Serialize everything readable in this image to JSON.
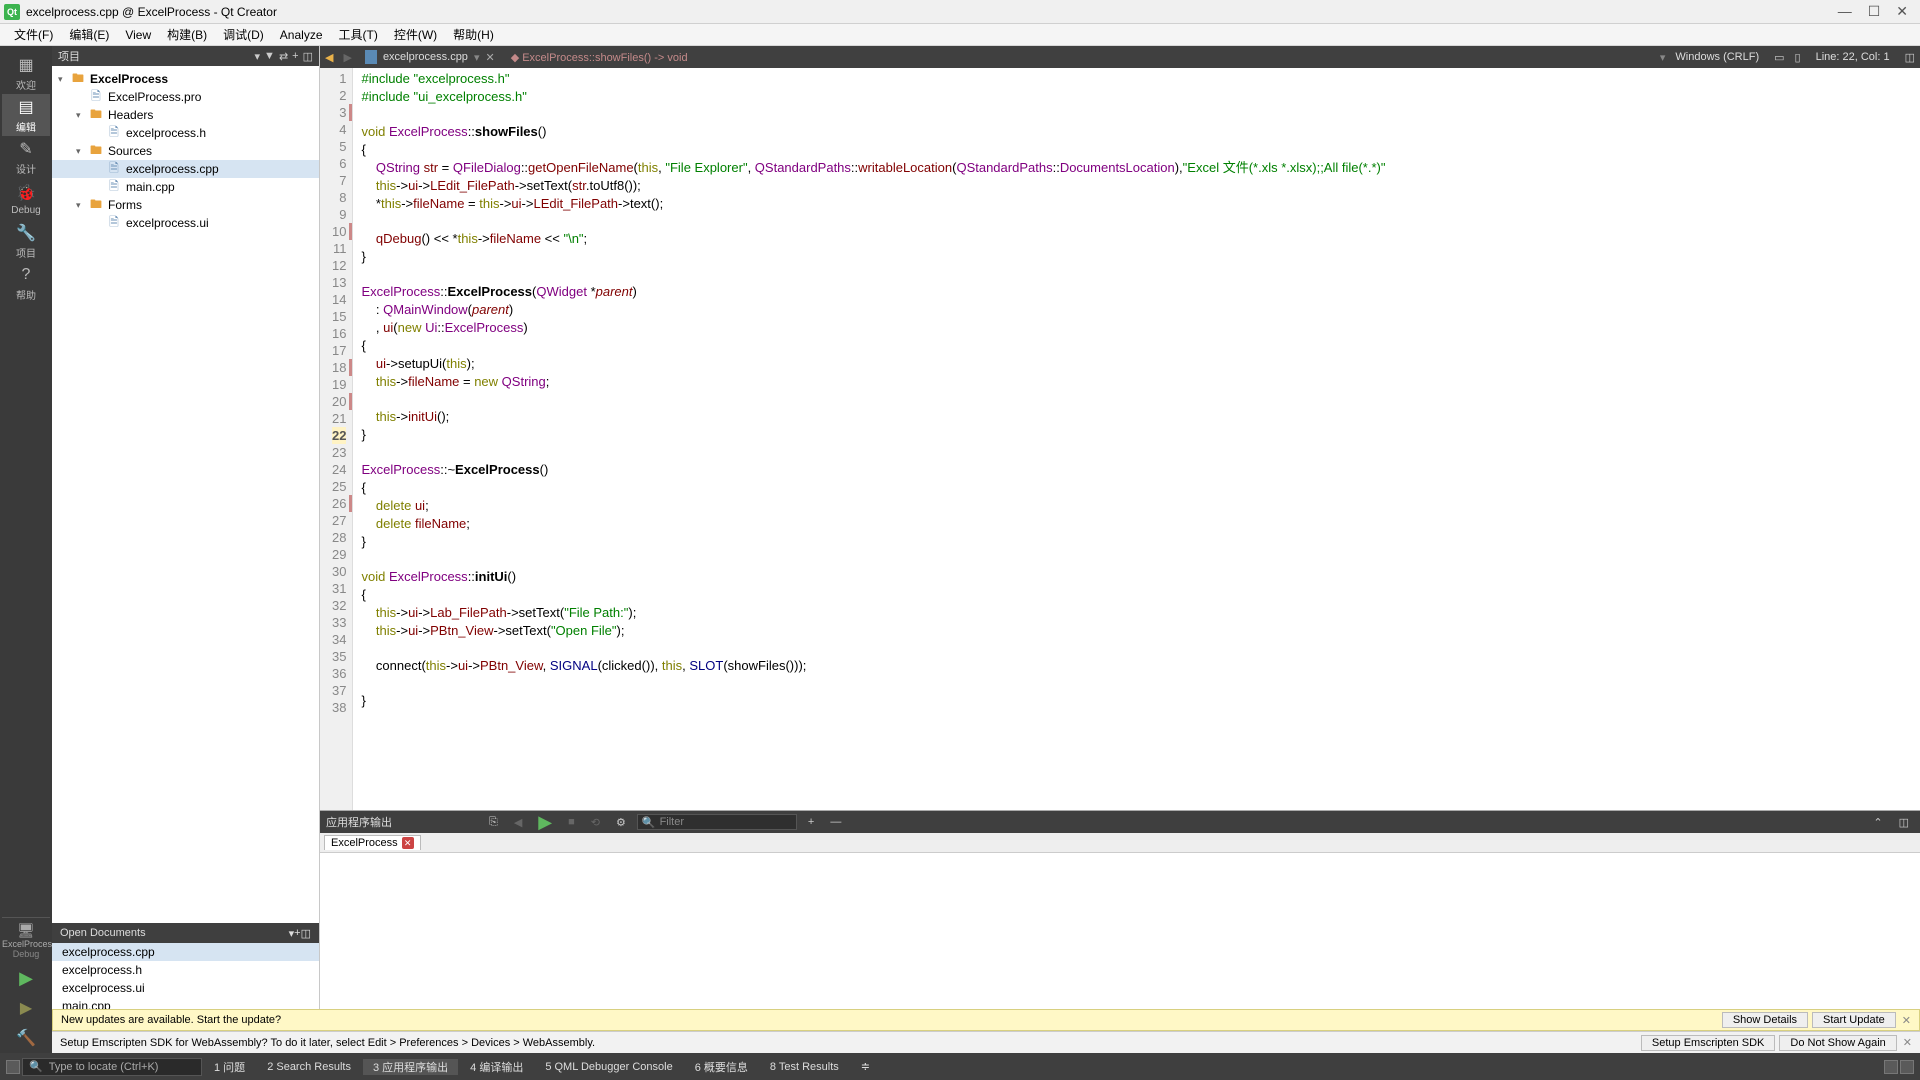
{
  "window": {
    "title": "excelprocess.cpp @ ExcelProcess - Qt Creator"
  },
  "menu": {
    "file": "文件(F)",
    "edit": "编辑(E)",
    "view": "View",
    "build": "构建(B)",
    "debug": "调试(D)",
    "analyze": "Analyze",
    "tools": "工具(T)",
    "widgets": "控件(W)",
    "help": "帮助(H)"
  },
  "rail": {
    "welcome": "欢迎",
    "edit": "编辑",
    "design": "设计",
    "debug": "Debug",
    "project": "项目",
    "help": "帮助",
    "target": "ExcelProcess",
    "config": "Debug"
  },
  "projectPane": {
    "title": "项目",
    "root": "ExcelProcess",
    "pro": "ExcelProcess.pro",
    "headers": "Headers",
    "h1": "excelprocess.h",
    "sources": "Sources",
    "s1": "excelprocess.cpp",
    "s2": "main.cpp",
    "forms": "Forms",
    "f1": "excelprocess.ui"
  },
  "openDocs": {
    "title": "Open Documents",
    "d1": "excelprocess.cpp",
    "d2": "excelprocess.h",
    "d3": "excelprocess.ui",
    "d4": "main.cpp"
  },
  "editor": {
    "filename": "excelprocess.cpp",
    "breadcrumb": "ExcelProcess::showFiles() -> void",
    "encoding": "Windows (CRLF)",
    "pos": "Line: 22, Col: 1"
  },
  "output": {
    "title": "应用程序输出",
    "filterPlaceholder": "Filter",
    "tab": "ExcelProcess"
  },
  "notif1": {
    "text": "New updates are available. Start the update?",
    "b1": "Show Details",
    "b2": "Start Update"
  },
  "notif2": {
    "text": "Setup Emscripten SDK for WebAssembly? To do it later, select Edit > Preferences > Devices > WebAssembly.",
    "b1": "Setup Emscripten SDK",
    "b2": "Do Not Show Again"
  },
  "status": {
    "locatePlaceholder": "Type to locate (Ctrl+K)",
    "t1": "1  问题",
    "t2": "2  Search Results",
    "t3": "3  应用程序输出",
    "t4": "4  编译输出",
    "t5": "5  QML Debugger Console",
    "t6": "6  概要信息",
    "t7": "8  Test Results"
  },
  "code": {
    "l1a": "#include ",
    "l1b": "\"excelprocess.h\"",
    "l2a": "#include ",
    "l2b": "\"ui_excelprocess.h\"",
    "l4a": "void ",
    "l4b": "ExcelProcess",
    "l4c": "::",
    "l4d": "showFiles",
    "l4e": "()",
    "l5": "{",
    "l6a": "    QString ",
    "l6b": "str",
    "l6c": " = ",
    "l6d": "QFileDialog",
    "l6e": "::",
    "l6f": "getOpenFileName",
    "l6g": "(",
    "l6h": "this",
    "l6i": ", ",
    "l6j": "\"File Explorer\"",
    "l6k": ", ",
    "l6l": "QStandardPaths",
    "l6m": "::",
    "l6n": "writableLocation",
    "l6o": "(",
    "l6p": "QStandardPaths",
    "l6q": "::",
    "l6r": "DocumentsLocation",
    "l6s": "),",
    "l6t": "\"Excel 文件(*.xls *.xlsx);;All file(*.*)\"",
    "l7a": "    this",
    "l7b": "->",
    "l7c": "ui",
    "l7d": "->",
    "l7e": "LEdit_FilePath",
    "l7f": "->",
    "l7g": "setText",
    "l7h": "(",
    "l7i": "str",
    "l7j": ".",
    "l7k": "toUtf8",
    "l7l": "());",
    "l8a": "    *",
    "l8b": "this",
    "l8c": "->",
    "l8d": "fileName",
    "l8e": " = ",
    "l8f": "this",
    "l8g": "->",
    "l8h": "ui",
    "l8i": "->",
    "l8j": "LEdit_FilePath",
    "l8k": "->",
    "l8l": "text",
    "l8m": "();",
    "l10a": "    qDebug",
    "l10b": "() << *",
    "l10c": "this",
    "l10d": "->",
    "l10e": "fileName",
    "l10f": " << ",
    "l10g": "\"\\n\"",
    "l10h": ";",
    "l11": "}",
    "l13a": "ExcelProcess",
    "l13b": "::",
    "l13c": "ExcelProcess",
    "l13d": "(",
    "l13e": "QWidget ",
    "l13f": "*",
    "l13g": "parent",
    "l13h": ")",
    "l14a": "    : ",
    "l14b": "QMainWindow",
    "l14c": "(",
    "l14d": "parent",
    "l14e": ")",
    "l15a": "    , ",
    "l15b": "ui",
    "l15c": "(",
    "l15d": "new ",
    "l15e": "Ui",
    "l15f": "::",
    "l15g": "ExcelProcess",
    "l15h": ")",
    "l16": "{",
    "l17a": "    ui",
    "l17b": "->",
    "l17c": "setupUi",
    "l17d": "(",
    "l17e": "this",
    "l17f": ");",
    "l18a": "    this",
    "l18b": "->",
    "l18c": "fileName",
    "l18d": " = ",
    "l18e": "new ",
    "l18f": "QString",
    "l18g": ";",
    "l20a": "    this",
    "l20b": "->",
    "l20c": "initUi",
    "l20d": "();",
    "l21": "}",
    "l22": "",
    "l23a": "ExcelProcess",
    "l23b": "::~",
    "l23c": "ExcelProcess",
    "l23d": "()",
    "l24": "{",
    "l25a": "    delete ",
    "l25b": "ui",
    "l25c": ";",
    "l26a": "    delete ",
    "l26b": "fileName",
    "l26c": ";",
    "l27": "}",
    "l29a": "void ",
    "l29b": "ExcelProcess",
    "l29c": "::",
    "l29d": "initUi",
    "l29e": "()",
    "l30": "{",
    "l31a": "    this",
    "l31b": "->",
    "l31c": "ui",
    "l31d": "->",
    "l31e": "Lab_FilePath",
    "l31f": "->",
    "l31g": "setText",
    "l31h": "(",
    "l31i": "\"File Path:\"",
    "l31j": ");",
    "l32a": "    this",
    "l32b": "->",
    "l32c": "ui",
    "l32d": "->",
    "l32e": "PBtn_View",
    "l32f": "->",
    "l32g": "setText",
    "l32h": "(",
    "l32i": "\"Open File\"",
    "l32j": ");",
    "l34a": "    connect",
    "l34b": "(",
    "l34c": "this",
    "l34d": "->",
    "l34e": "ui",
    "l34f": "->",
    "l34g": "PBtn_View",
    "l34h": ", ",
    "l34i": "SIGNAL",
    "l34j": "(",
    "l34k": "clicked",
    "l34l": "()), ",
    "l34m": "this",
    "l34n": ", ",
    "l34o": "SLOT",
    "l34p": "(",
    "l34q": "showFiles",
    "l34r": "()));",
    "l36": "}"
  }
}
